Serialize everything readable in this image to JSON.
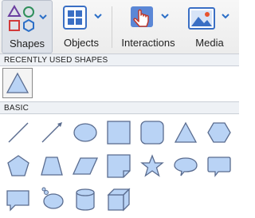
{
  "toolbar": {
    "shapes_label": "Shapes",
    "objects_label": "Objects",
    "interactions_label": "Interactions",
    "media_label": "Media"
  },
  "sections": {
    "recent": "RECENTLY USED SHAPES",
    "basic": "BASIC"
  },
  "icons": {
    "shapes": "shapes-icon",
    "objects": "objects-grid-icon",
    "interactions": "pointer-hand-icon",
    "media": "image-icon"
  },
  "colors": {
    "shape_fill": "#b9d3f5",
    "shape_stroke": "#5a6c8f",
    "accent": "#4a78c9"
  },
  "recent_shapes": [
    "triangle"
  ],
  "basic_shapes": [
    "line",
    "arrow",
    "oval",
    "rectangle",
    "rounded-rectangle",
    "triangle",
    "hexagon",
    "pentagon",
    "trapezoid",
    "parallelogram",
    "folded-corner",
    "star",
    "oval-callout",
    "rectangle-callout",
    "square-callout",
    "thought-bubble",
    "cylinder",
    "cube"
  ]
}
